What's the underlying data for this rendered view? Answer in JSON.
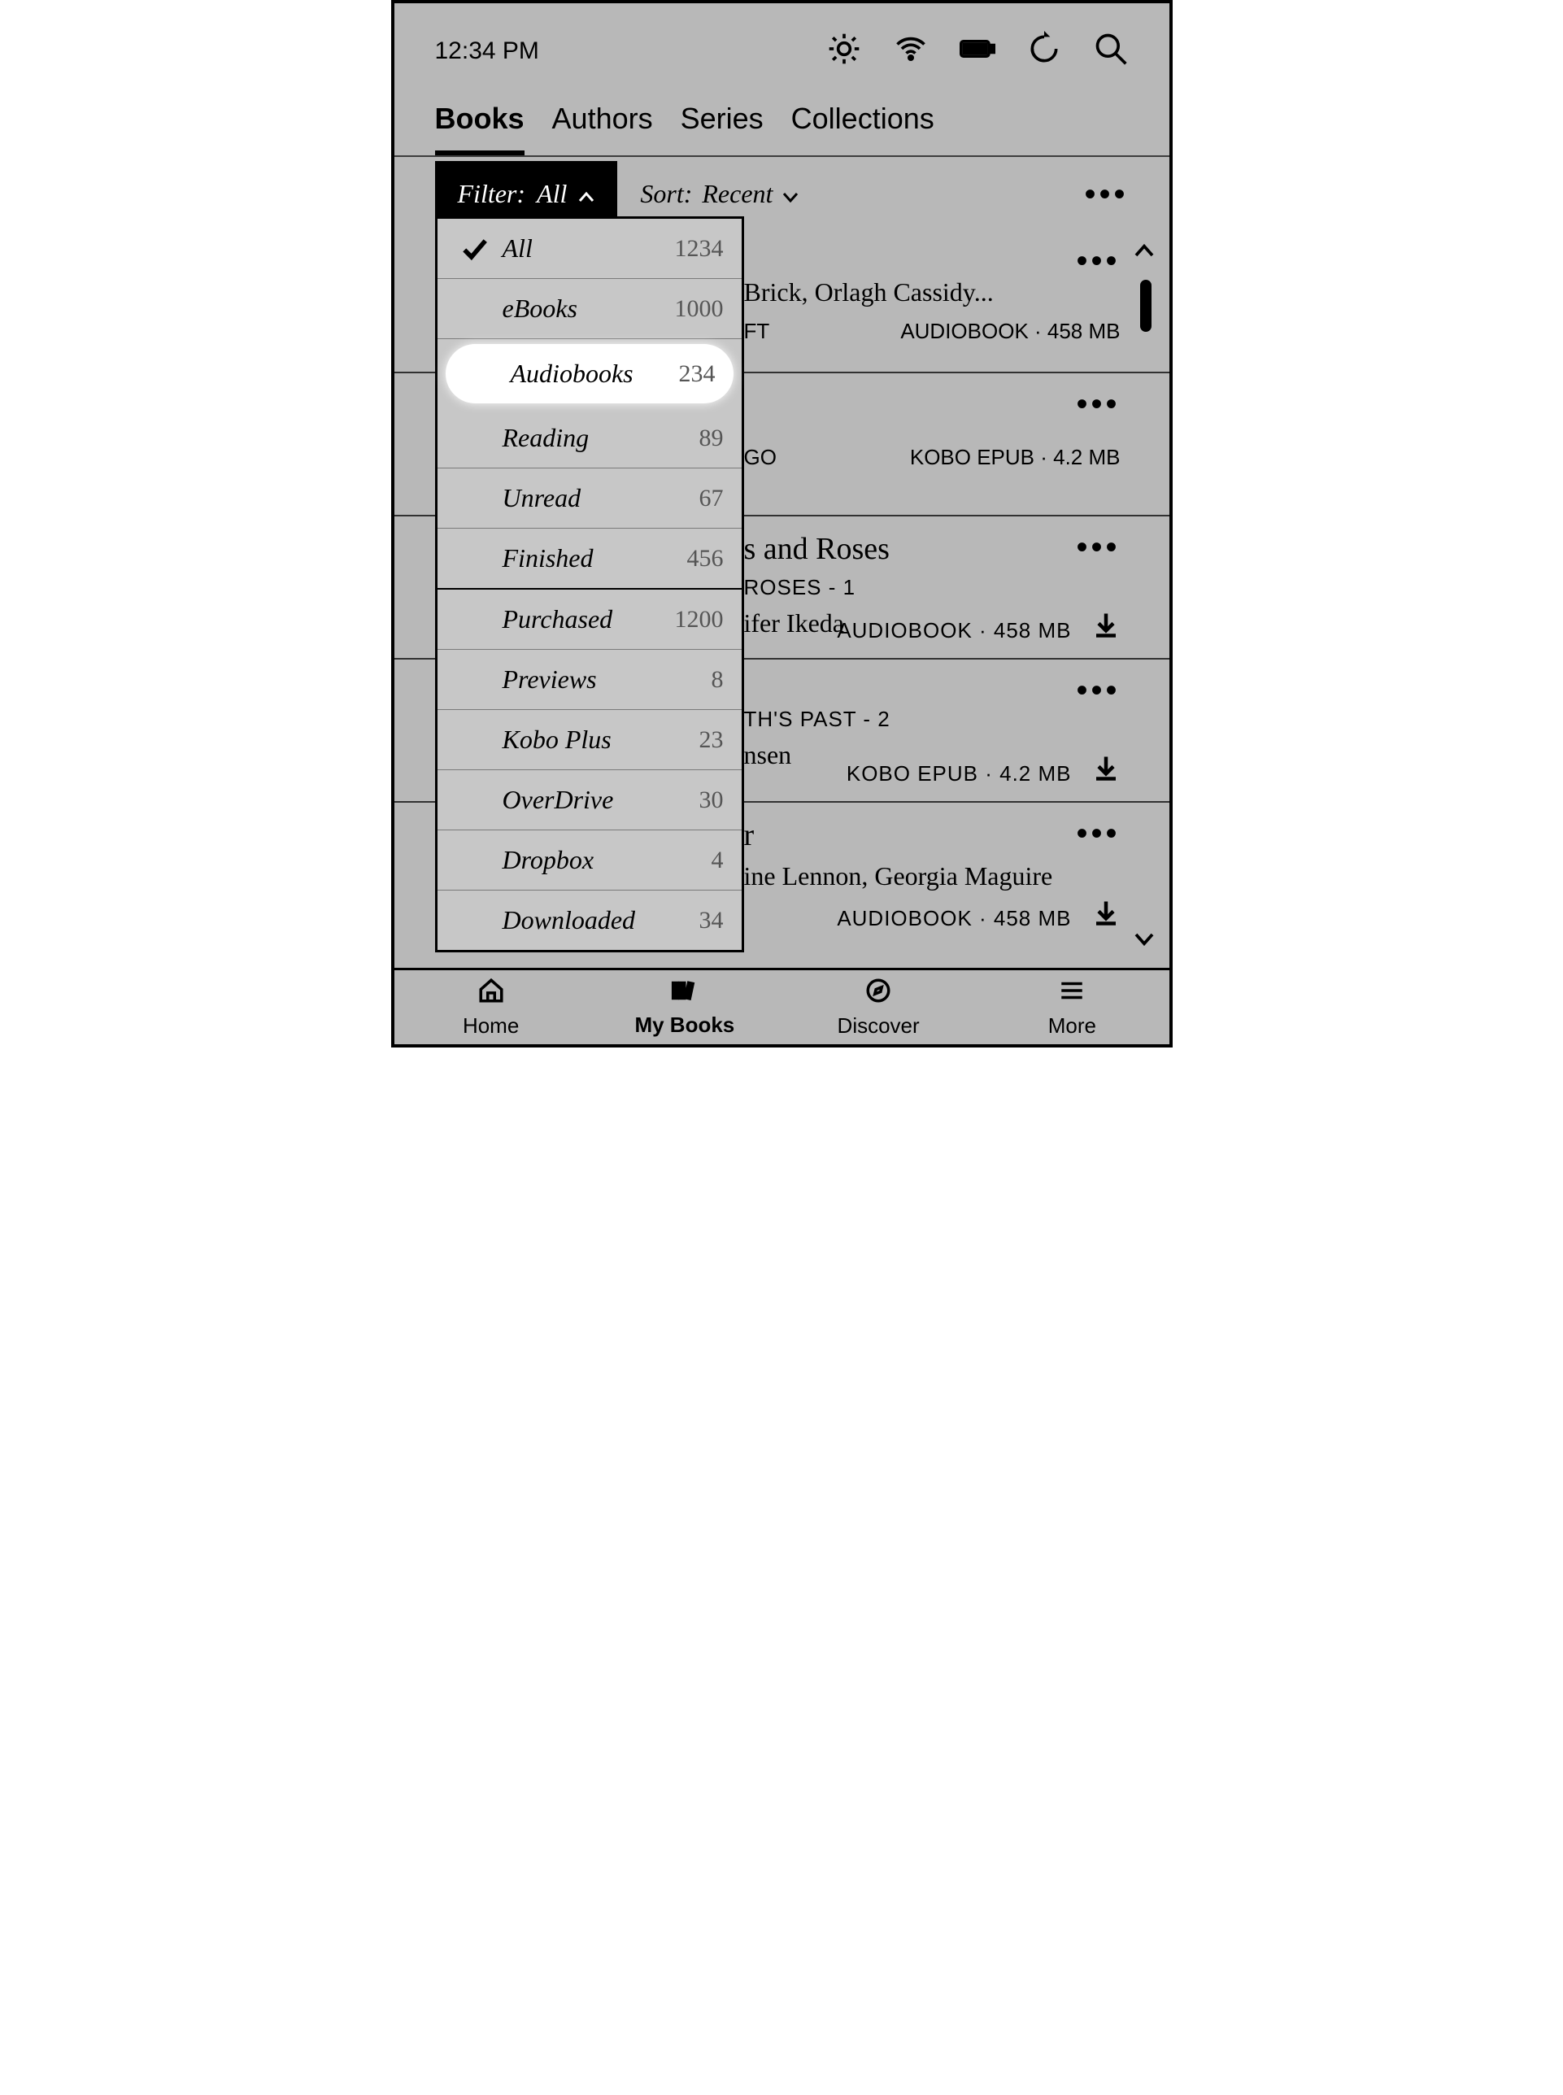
{
  "status": {
    "time": "12:34 PM"
  },
  "tabs": [
    "Books",
    "Authors",
    "Series",
    "Collections"
  ],
  "active_tab": 0,
  "filter": {
    "prefix": "Filter:",
    "value": "All"
  },
  "sort": {
    "prefix": "Sort:",
    "value": "Recent"
  },
  "filter_options": [
    {
      "name": "All",
      "count": "1234",
      "checked": true,
      "divider": "light"
    },
    {
      "name": "eBooks",
      "count": "1000",
      "divider": "light"
    },
    {
      "name": "Audiobooks",
      "count": "234",
      "highlight": true,
      "divider": "heavy"
    },
    {
      "name": "Reading",
      "count": "89",
      "divider": "light"
    },
    {
      "name": "Unread",
      "count": "67",
      "divider": "light"
    },
    {
      "name": "Finished",
      "count": "456",
      "divider": "heavy"
    },
    {
      "name": "Purchased",
      "count": "1200",
      "divider": "light"
    },
    {
      "name": "Previews",
      "count": "8",
      "divider": "light"
    },
    {
      "name": "Kobo Plus",
      "count": "23",
      "divider": "light"
    },
    {
      "name": "OverDrive",
      "count": "30",
      "divider": "light"
    },
    {
      "name": "Dropbox",
      "count": "4",
      "divider": "light"
    },
    {
      "name": "Downloaded",
      "count": "34",
      "divider": "none"
    }
  ],
  "books": [
    {
      "narr_frag": "Brick, Orlagh Cassidy...",
      "line2": "FT",
      "meta": "AUDIOBOOK · 458 MB",
      "dl": false
    },
    {
      "line2": "GO",
      "meta": "KOBO EPUB · 4.2 MB",
      "dl": false
    },
    {
      "title_frag": "s and Roses",
      "series_frag": "ROSES - 1",
      "narr_frag": "ifer Ikeda",
      "meta": "AUDIOBOOK · 458 MB",
      "dl": true
    },
    {
      "series_frag": "TH'S PAST - 2",
      "narr_frag": "nsen",
      "meta": "KOBO EPUB · 4.2 MB",
      "dl": true
    },
    {
      "title_frag": "r",
      "narr_frag": "ine Lennon, Georgia Maguire",
      "meta": "AUDIOBOOK · 458 MB",
      "dl": true
    }
  ],
  "nav": [
    {
      "label": "Home"
    },
    {
      "label": "My Books",
      "active": true
    },
    {
      "label": "Discover"
    },
    {
      "label": "More"
    }
  ]
}
